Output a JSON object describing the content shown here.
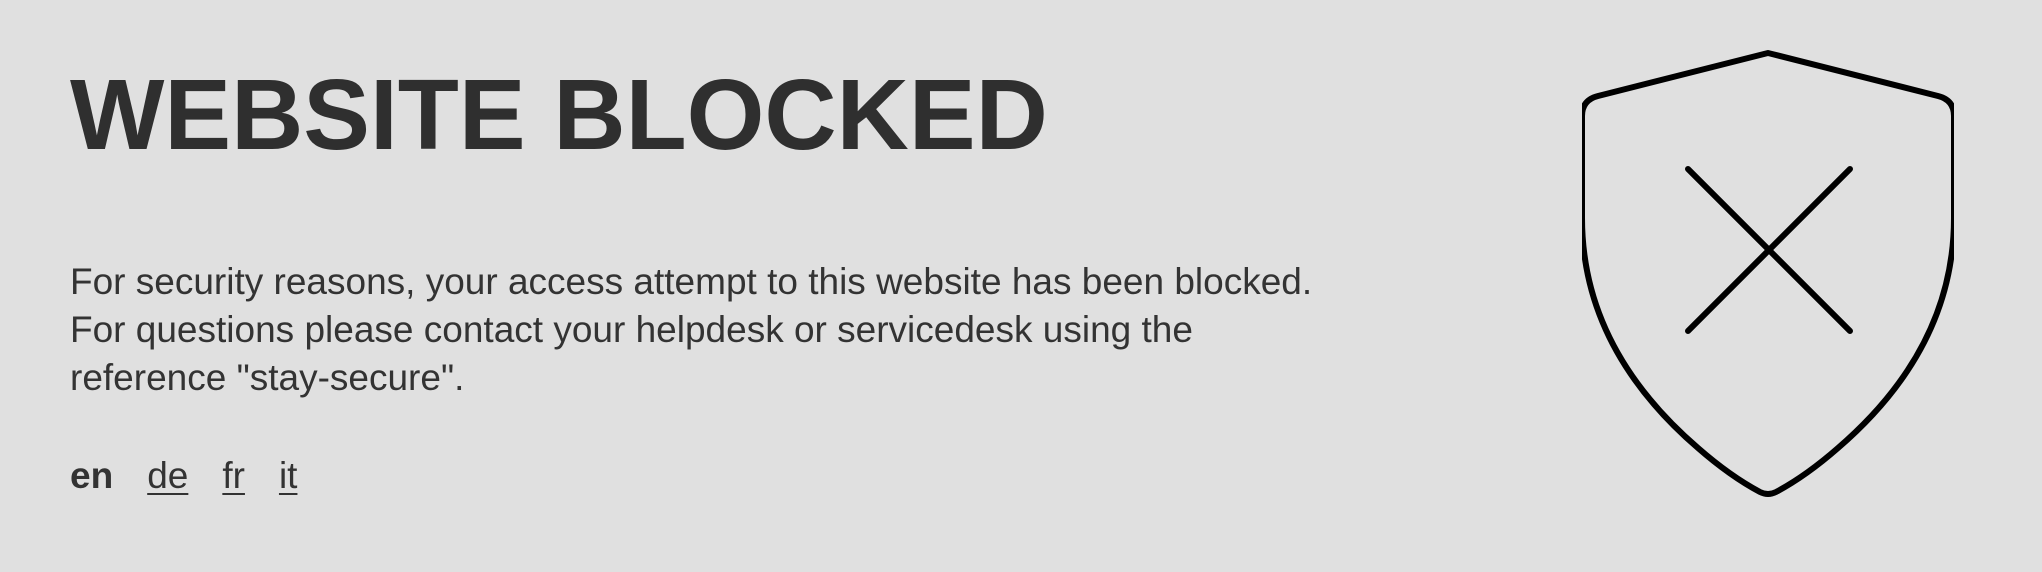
{
  "page": {
    "title": "WEBSITE BLOCKED",
    "message_lines": [
      "For security reasons, your access attempt to this website has been blocked.",
      "For questions please contact your helpdesk or servicedesk using the",
      "reference \"stay-secure\"."
    ]
  },
  "languages": {
    "current": "en",
    "options": [
      "de",
      "fr",
      "it"
    ]
  },
  "icons": {
    "shield": "shield-x-icon"
  },
  "colors": {
    "background": "#e0e0e0",
    "text": "#303030",
    "icon_stroke": "#000000"
  }
}
